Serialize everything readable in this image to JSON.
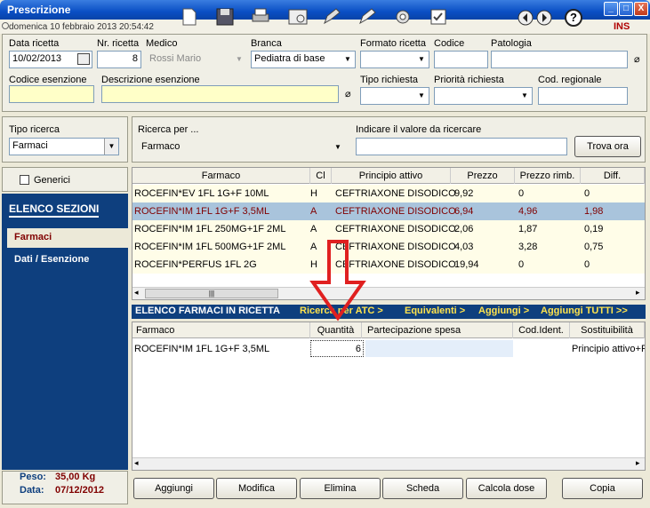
{
  "window": {
    "title": "Prescrizione",
    "minimize": "_",
    "maximize": "□",
    "close": "X"
  },
  "status": {
    "datetime": "domenica 10 febbraio 2013     20:54:42",
    "mode": "INS"
  },
  "toolbar": {
    "prev_icon": "arrow-left-icon",
    "next_icon": "arrow-right-icon",
    "help": "?"
  },
  "header": {
    "data_ricetta_label": "Data ricetta",
    "data_ricetta": "10/02/2013",
    "nr_ricetta_label": "Nr. ricetta",
    "nr_ricetta": "8",
    "medico_label": "Medico",
    "medico": "Rossi Mario",
    "branca_label": "Branca",
    "branca": "Pediatra di base",
    "formato_label": "Formato ricetta",
    "formato": "",
    "codice_label": "Codice",
    "codice": "",
    "patologia_label": "Patologia",
    "patologia": "",
    "cod_esenzione_label": "Codice esenzione",
    "cod_esenzione": "",
    "desc_esenzione_label": "Descrizione esenzione",
    "desc_esenzione": "",
    "tipo_richiesta_label": "Tipo richiesta",
    "tipo_richiesta": "",
    "priorita_label": "Priorità richiesta",
    "priorita": "",
    "cod_regionale_label": "Cod. regionale",
    "cod_regionale": ""
  },
  "search": {
    "tipo_label": "Tipo ricerca",
    "tipo": "Farmaci",
    "per_label": "Ricerca per ...",
    "per": "Farmaco",
    "valore_label": "Indicare il valore da ricercare",
    "valore": "",
    "trova": "Trova ora"
  },
  "generici": "Generici",
  "nav": {
    "title": "ELENCO SEZIONI",
    "items": [
      "Farmaci",
      "Dati / Esenzione"
    ],
    "peso_label": "Peso:",
    "peso": "35,00 Kg",
    "data_label": "Data:",
    "data": "07/12/2012"
  },
  "results": {
    "headers": [
      "Farmaco",
      "Cl",
      "Principio attivo",
      "Prezzo",
      "Prezzo rimb.",
      "Diff."
    ],
    "rows": [
      [
        "ROCEFIN*EV 1FL 1G+F 10ML",
        "H",
        "CEFTRIAXONE DISODICO",
        "9,92",
        "0",
        "0"
      ],
      [
        "ROCEFIN*IM 1FL 1G+F 3,5ML",
        "A",
        "CEFTRIAXONE DISODICO",
        "6,94",
        "4,96",
        "1,98"
      ],
      [
        "ROCEFIN*IM 1FL 250MG+1F 2ML",
        "A",
        "CEFTRIAXONE DISODICO",
        "2,06",
        "1,87",
        "0,19"
      ],
      [
        "ROCEFIN*IM 1FL 500MG+1F 2ML",
        "A",
        "CEFTRIAXONE DISODICO",
        "4,03",
        "3,28",
        "0,75"
      ],
      [
        "ROCEFIN*PERFUS 1FL 2G",
        "H",
        "CEFTRIAXONE DISODICO",
        "19,94",
        "0",
        "0"
      ]
    ]
  },
  "links": {
    "elenco": "ELENCO FARMACI IN RICETTA",
    "ricerca_atc": "Ricerca per ATC >",
    "equivalenti": "Equivalenti >",
    "aggiungi": "Aggiungi >",
    "aggiungi_tutti": "Aggiungi TUTTI >>"
  },
  "prescribed": {
    "headers": [
      "Farmaco",
      "Quantità",
      "Partecipazione spesa",
      "Cod.Ident.",
      "Sostituibilità"
    ],
    "rows": [
      [
        "ROCEFIN*IM 1FL 1G+F 3,5ML",
        "6",
        "",
        "",
        "Principio attivo+F"
      ]
    ]
  },
  "buttons": [
    "Aggiungi",
    "Modifica",
    "Elimina",
    "Scheda",
    "Calcola dose",
    "Copia"
  ],
  "colors": {
    "title_blue": "#0a4fc4",
    "nav_blue": "#0e3f7e",
    "selected_row": "#a9c4dc",
    "arrow_red": "#e02020",
    "text_dark_red": "#800000"
  }
}
